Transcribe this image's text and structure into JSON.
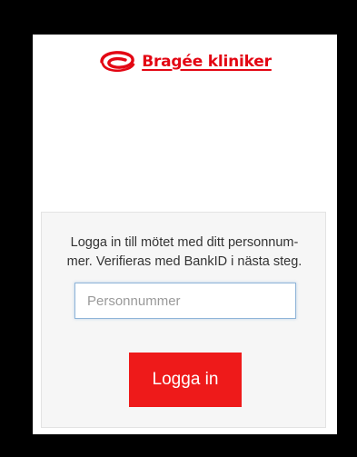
{
  "brand": {
    "name": "Bragée kliniker",
    "logo_icon": "bragee-swirl-logo-icon",
    "color": "#e30613"
  },
  "login": {
    "instructions": "Logga in till mötet med ditt personnum-mer. Verifieras med BankID i nästa steg.",
    "instructions_line_1": "Logga in till mötet med ditt personnum-",
    "instructions_line_2": "mer. Verifieras med BankID i nästa steg.",
    "personnummer_placeholder": "Personnummer",
    "personnummer_value": "",
    "button_label": "Logga in",
    "button_color": "#ee1a1a"
  }
}
